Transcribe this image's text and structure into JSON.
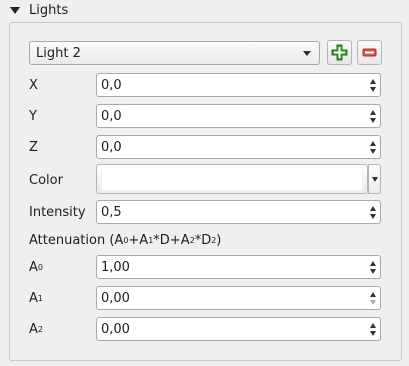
{
  "section": {
    "title": "Lights"
  },
  "light_select": {
    "value": "Light 2"
  },
  "fields": {
    "x": {
      "label": "X",
      "value": "0,0"
    },
    "y": {
      "label": "Y",
      "value": "0,0"
    },
    "z": {
      "label": "Z",
      "value": "0,0"
    },
    "color": {
      "label": "Color",
      "value": "#ffffff"
    },
    "intensity": {
      "label": "Intensity",
      "value": "0,5"
    }
  },
  "attenuation": {
    "label_prefix": "Attenuation (A",
    "a0_label": "A",
    "a0_sub": "0",
    "a0_value": "1,00",
    "a1_label": "A",
    "a1_sub": "1",
    "a1_value": "0,00",
    "a2_label": "A",
    "a2_sub": "2",
    "a2_value": "0,00"
  },
  "icons": {
    "add": "plus-icon",
    "remove": "minus-icon"
  },
  "colors": {
    "add_green": "#3c9a2b",
    "remove_red": "#d9534f"
  }
}
